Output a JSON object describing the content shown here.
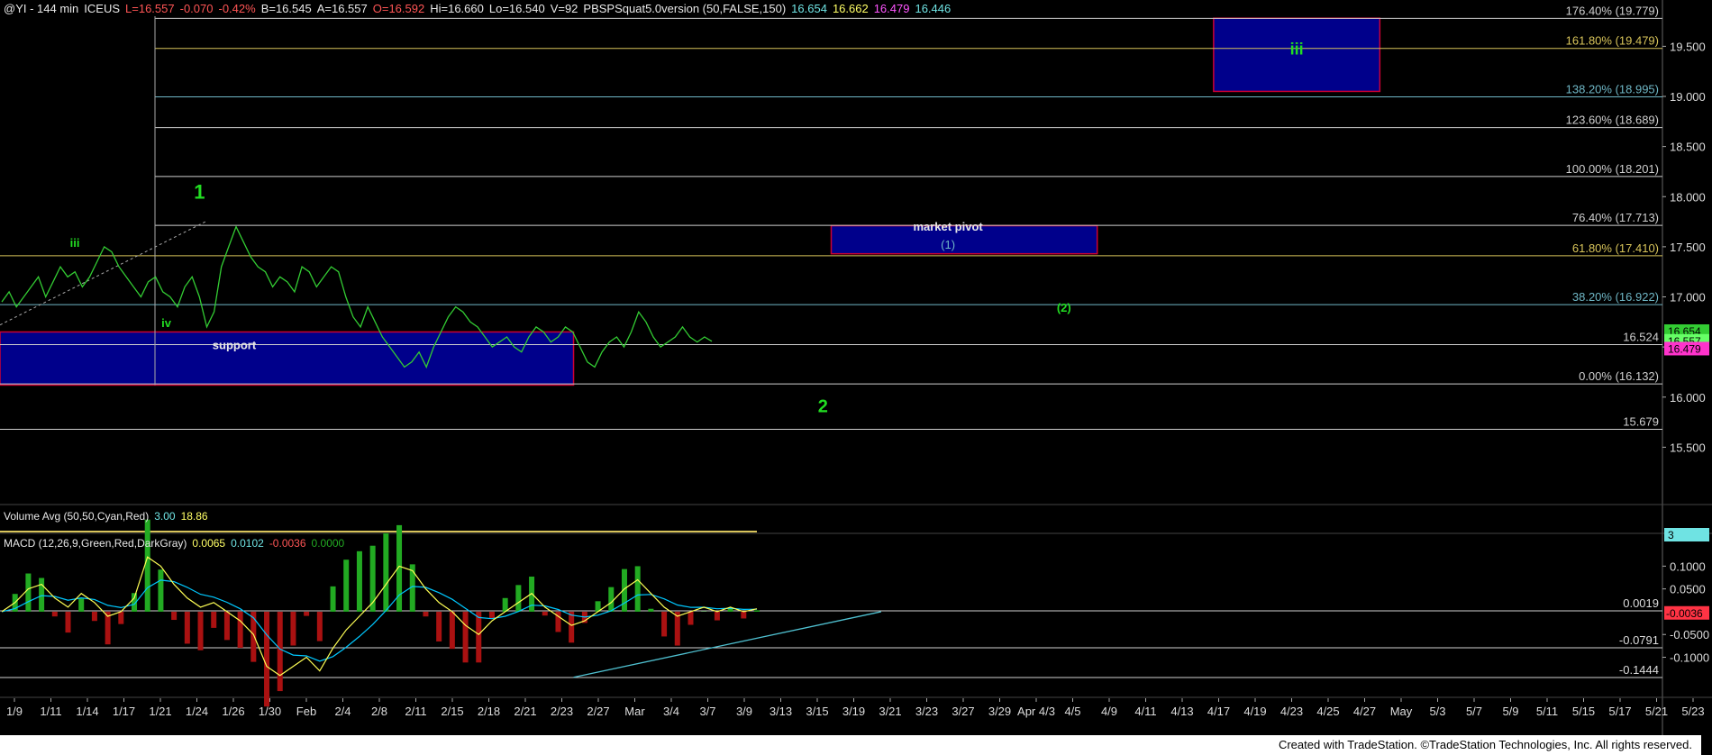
{
  "header": {
    "symbol": "@YI - 144 min",
    "exchange": "ICEUS",
    "last": "L=16.557",
    "chg": "-0.070",
    "pct": "-0.42%",
    "bid": "B=16.545",
    "ask": "A=16.557",
    "open": "O=16.592",
    "hi": "Hi=16.660",
    "lo": "Lo=16.540",
    "vol": "V=92",
    "study": "PBSPSquat5.0version (50,FALSE,150)",
    "study_values": [
      "16.654",
      "16.662",
      "16.479",
      "16.446"
    ]
  },
  "colors": {
    "background": "#000000",
    "price_line": "#33cc33",
    "fib_text": "#ffffff",
    "fib_gold": "#d8c45a",
    "fib_teal": "#6fb7c6",
    "box_fill": "#00008b",
    "box_border": "#cc0033",
    "wave_green": "#22dd22",
    "macd_line": "#00c8ff",
    "signal_line": "#ffff55",
    "hist_pos": "#22aa22",
    "hist_neg": "#aa1111",
    "trendline": "#4fc0d0"
  },
  "chart_data": {
    "type": "line",
    "title": "@YI - 144 min",
    "ylim": [
      15.0,
      19.8
    ],
    "price_ticks": [
      "19.500",
      "19.000",
      "18.500",
      "18.000",
      "17.500",
      "17.000",
      "16.500",
      "16.000",
      "15.500"
    ],
    "x_labels": [
      "1/9",
      "1/11",
      "1/14",
      "1/17",
      "1/21",
      "1/24",
      "1/26",
      "1/30",
      "Feb",
      "2/4",
      "2/8",
      "2/11",
      "2/15",
      "2/18",
      "2/21",
      "2/23",
      "2/27",
      "Mar",
      "3/4",
      "3/7",
      "3/9",
      "3/13",
      "3/15",
      "3/19",
      "3/21",
      "3/23",
      "3/27",
      "3/29",
      "Apr 4/3",
      "4/5",
      "4/9",
      "4/11",
      "4/13",
      "4/17",
      "4/19",
      "4/23",
      "4/25",
      "4/27",
      "May",
      "5/3",
      "5/7",
      "5/9",
      "5/11",
      "5/15",
      "5/17",
      "5/21",
      "5/23"
    ],
    "price_series": [
      {
        "name": "price",
        "values": [
          16.95,
          17.05,
          16.9,
          17.0,
          17.1,
          17.2,
          17.0,
          17.15,
          17.3,
          17.2,
          17.25,
          17.1,
          17.2,
          17.35,
          17.5,
          17.45,
          17.3,
          17.2,
          17.1,
          17.0,
          17.15,
          17.2,
          17.05,
          17.0,
          16.9,
          17.1,
          17.2,
          17.0,
          16.7,
          16.85,
          17.3,
          17.5,
          17.7,
          17.55,
          17.4,
          17.3,
          17.25,
          17.1,
          17.2,
          17.15,
          17.05,
          17.3,
          17.25,
          17.1,
          17.2,
          17.3,
          17.25,
          17.0,
          16.8,
          16.7,
          16.9,
          16.75,
          16.6,
          16.5,
          16.4,
          16.3,
          16.35,
          16.45,
          16.3,
          16.5,
          16.65,
          16.8,
          16.9,
          16.85,
          16.75,
          16.7,
          16.6,
          16.5,
          16.55,
          16.6,
          16.5,
          16.45,
          16.6,
          16.7,
          16.65,
          16.55,
          16.6,
          16.7,
          16.65,
          16.5,
          16.35,
          16.3,
          16.45,
          16.55,
          16.6,
          16.5,
          16.65,
          16.85,
          16.75,
          16.6,
          16.5,
          16.55,
          16.6,
          16.7,
          16.6,
          16.55,
          16.6,
          16.557
        ]
      }
    ],
    "fib_levels": [
      {
        "label": "176.40% (19.779)",
        "value": 19.779,
        "tone": "white"
      },
      {
        "label": "161.80% (19.479)",
        "value": 19.479,
        "tone": "gold"
      },
      {
        "label": "138.20% (18.995)",
        "value": 18.995,
        "tone": "teal"
      },
      {
        "label": "123.60% (18.689)",
        "value": 18.689,
        "tone": "white"
      },
      {
        "label": "100.00% (18.201)",
        "value": 18.201,
        "tone": "white"
      },
      {
        "label": "76.40% (17.713)",
        "value": 17.713,
        "tone": "white"
      },
      {
        "label": "61.80% (17.410)",
        "value": 17.41,
        "tone": "gold"
      },
      {
        "label": "38.20% (16.922)",
        "value": 16.922,
        "tone": "teal"
      },
      {
        "label": "16.524",
        "value": 16.524,
        "tone": "white"
      },
      {
        "label": "0.00% (16.132)",
        "value": 16.132,
        "tone": "white"
      },
      {
        "label": "15.679",
        "value": 15.679,
        "tone": "white"
      }
    ],
    "right_badges": [
      {
        "text": "16.654",
        "value": 16.654,
        "color": "#33cc33"
      },
      {
        "text": "16.557",
        "value": 16.557,
        "color": "#66ff66"
      },
      {
        "text": "16.479",
        "value": 16.479,
        "color": "#ff33cc"
      }
    ],
    "boxes": [
      {
        "name": "support",
        "x0": 0,
        "x1": 0.345,
        "y0": 16.12,
        "y1": 16.65
      },
      {
        "name": "market pivot",
        "sub": "(1)",
        "x0": 0.5,
        "x1": 0.66,
        "y0": 17.43,
        "y1": 17.71
      },
      {
        "name": "iii",
        "x0": 0.73,
        "x1": 0.83,
        "y0": 19.05,
        "y1": 19.78
      }
    ],
    "wave_labels": [
      {
        "text": "1",
        "at": 0.12,
        "value": 17.98,
        "size": "big"
      },
      {
        "text": "iii",
        "at": 0.045,
        "value": 17.5,
        "size": "small"
      },
      {
        "text": "iv",
        "at": 0.1,
        "value": 16.7,
        "size": "small"
      },
      {
        "text": "(2)",
        "at": 0.64,
        "value": 16.85,
        "size": "small"
      },
      {
        "text": "2",
        "at": 0.495,
        "value": 15.85,
        "size": "mid"
      }
    ],
    "volume": {
      "label": "Volume Avg (50,50,Cyan,Red)",
      "values": [
        "3.00",
        "18.86"
      ],
      "badge": "3"
    },
    "macd": {
      "label": "MACD (12,26,9,Green,Red,DarkGray)",
      "values": [
        "0.0065",
        "0.0102",
        "-0.0036",
        "0.0000"
      ],
      "ylim": [
        -0.18,
        0.16
      ],
      "ticks": [
        "0.1000",
        "0.0500",
        "-0.0500",
        "-0.1000"
      ],
      "levels": [
        {
          "label": "0.0019",
          "value": 0.0019
        },
        {
          "label": "-0.0791",
          "value": -0.0791
        },
        {
          "label": "-0.1444",
          "value": -0.1444
        }
      ],
      "badge": "-0.0036",
      "macd_values": [
        0.0,
        0.02,
        0.05,
        0.06,
        0.03,
        0.01,
        0.04,
        0.02,
        -0.01,
        0.0,
        0.03,
        0.12,
        0.1,
        0.06,
        0.03,
        0.01,
        0.02,
        0.0,
        -0.02,
        -0.05,
        -0.12,
        -0.14,
        -0.12,
        -0.1,
        -0.13,
        -0.08,
        -0.04,
        -0.01,
        0.02,
        0.06,
        0.1,
        0.09,
        0.05,
        0.02,
        0.0,
        -0.03,
        -0.05,
        -0.02,
        0.0,
        0.02,
        0.04,
        0.01,
        -0.01,
        -0.03,
        -0.02,
        0.0,
        0.02,
        0.05,
        0.07,
        0.04,
        0.01,
        -0.01,
        0.0,
        0.01,
        0.0,
        0.01,
        0.0,
        0.0065
      ],
      "trendline": [
        [
          0.345,
          -0.144
        ],
        [
          0.9,
          -0.03
        ]
      ]
    },
    "watermark": "Created with TradeStation. ©TradeStation Technologies, Inc. All rights reserved."
  }
}
